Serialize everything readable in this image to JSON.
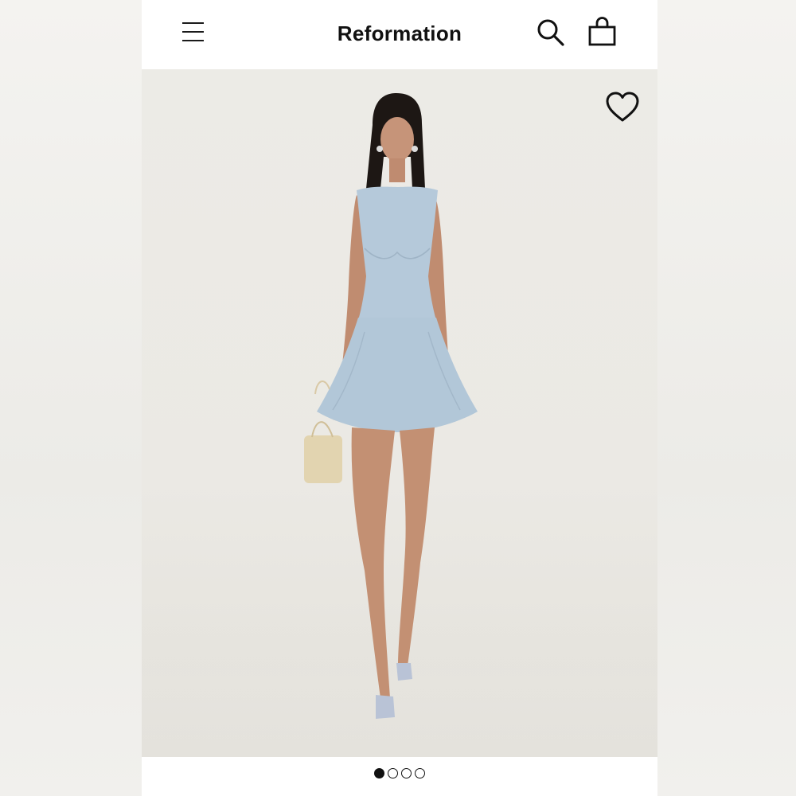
{
  "header": {
    "brand": "Reformation",
    "menu_icon": "hamburger-menu-icon",
    "search_icon": "search-icon",
    "bag_icon": "shopping-bag-icon"
  },
  "gallery": {
    "favorite_icon": "heart-outline-icon",
    "image_description_icon": "product-photo",
    "pagination": {
      "total": 4,
      "active_index": 0
    }
  },
  "colors": {
    "text": "#111111",
    "dress": "#b3c8d9",
    "background": "#ebe9e4"
  }
}
